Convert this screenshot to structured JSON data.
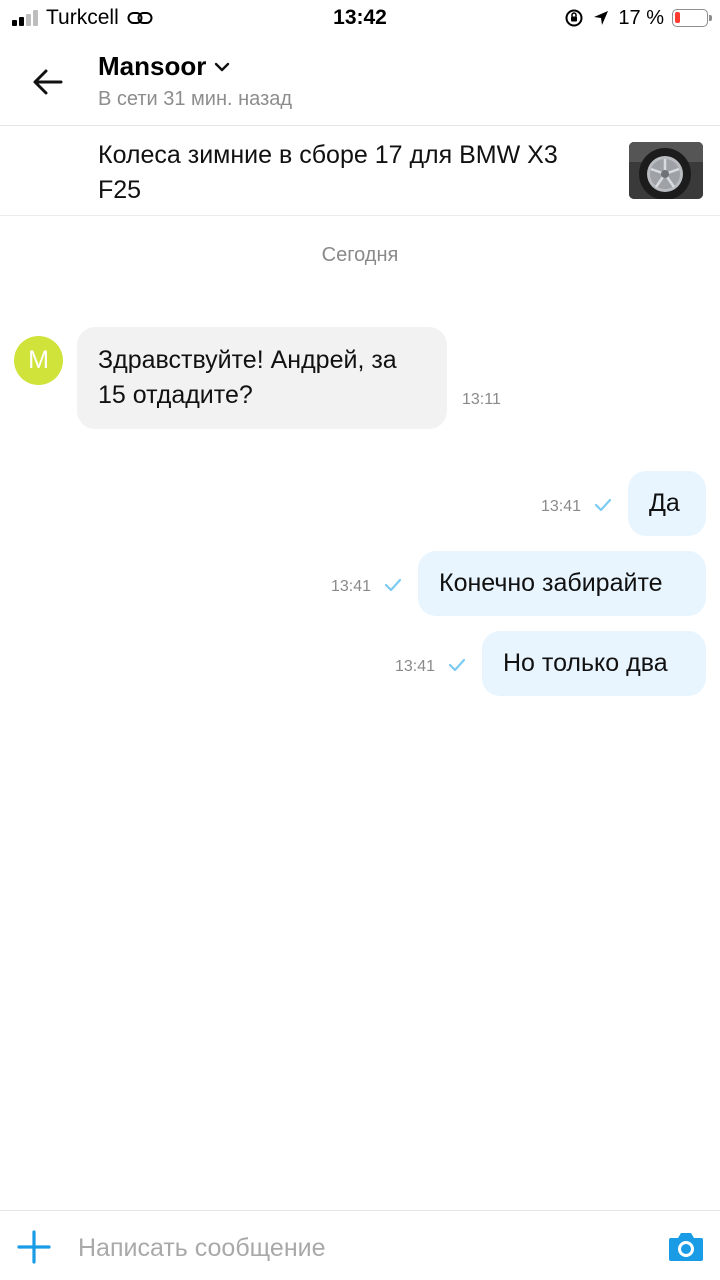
{
  "status_bar": {
    "carrier": "Turkcell",
    "time": "13:42",
    "battery_percent": "17 %",
    "battery_level": 0.17,
    "signal_bars": 2
  },
  "header": {
    "contact_name": "Mansoor",
    "contact_status": "В сети 31 мин. назад"
  },
  "listing": {
    "title": "Колеса зимние в сборе 17 для BMW X3 F25"
  },
  "chat": {
    "date_divider": "Сегодня",
    "avatar_initial": "M",
    "avatar_color": "#cfe33a",
    "incoming": [
      {
        "text": "Здравствуйте! Андрей, за 15 отдадите?",
        "time": "13:11"
      }
    ],
    "outgoing": [
      {
        "text": "Да",
        "time": "13:41"
      },
      {
        "text": "Конечно забирайте",
        "time": "13:41"
      },
      {
        "text": "Но только два",
        "time": "13:41"
      }
    ]
  },
  "composer": {
    "placeholder": "Написать сообщение"
  },
  "colors": {
    "accent": "#1a9be6",
    "incoming_bubble": "#f2f2f2",
    "outgoing_bubble": "#e8f5fe",
    "read_check": "#7ccbf2"
  }
}
